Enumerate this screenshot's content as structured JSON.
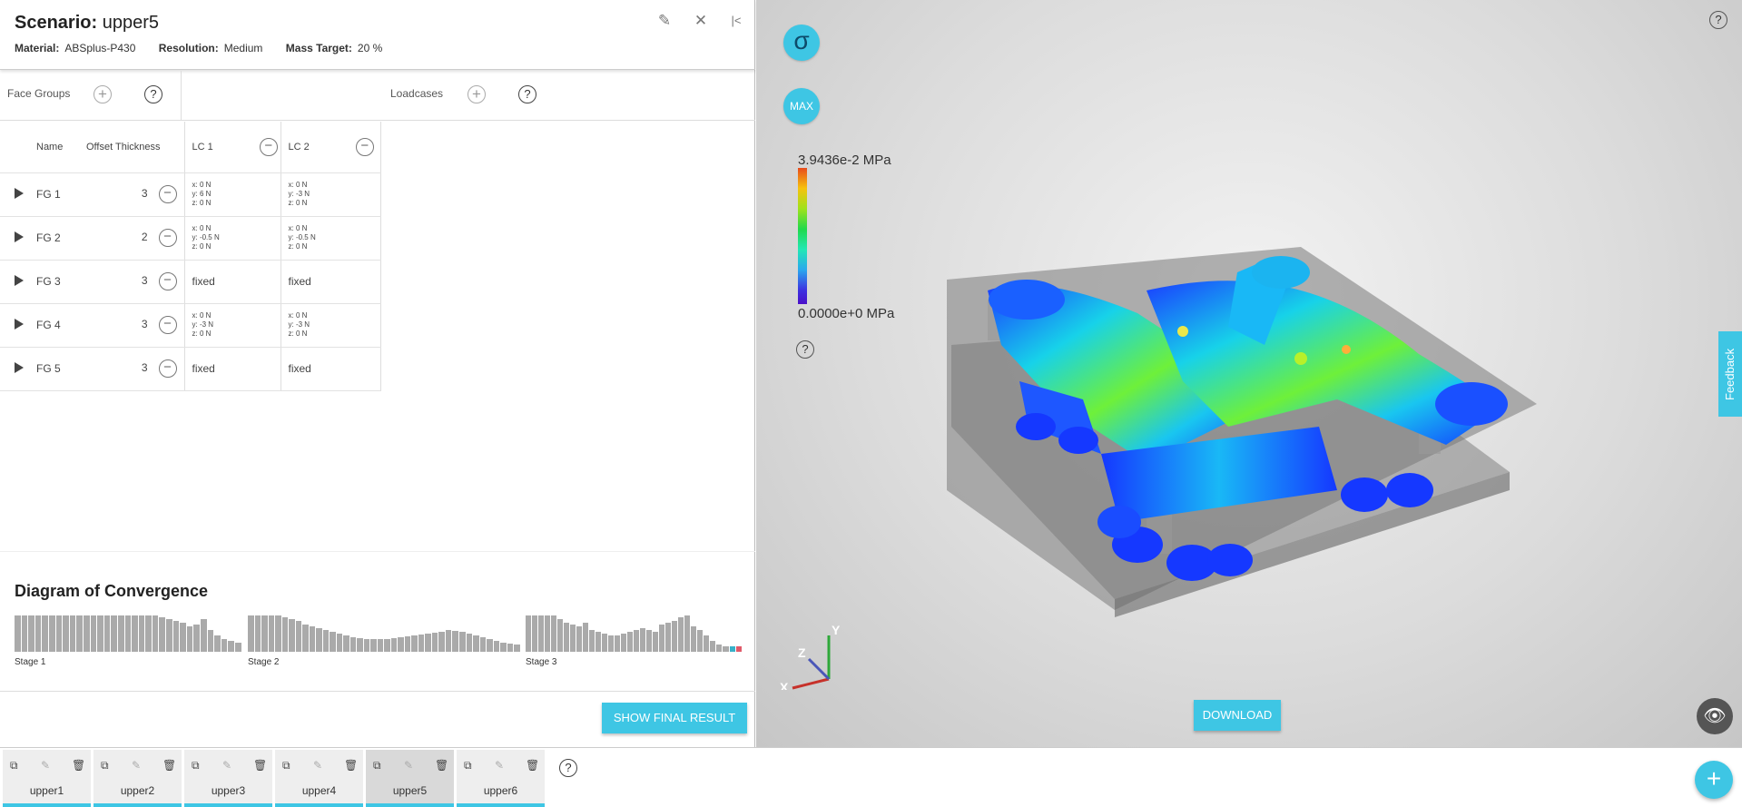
{
  "header": {
    "scenario_label": "Scenario:",
    "scenario_name": "upper5",
    "material_label": "Material:",
    "material": "ABSplus-P430",
    "resolution_label": "Resolution:",
    "resolution": "Medium",
    "mass_label": "Mass Target:",
    "mass": "20 %"
  },
  "sections": {
    "face_groups": "Face Groups",
    "loadcases": "Loadcases",
    "help": "?"
  },
  "table": {
    "col_name": "Name",
    "col_offset": "Offset Thickness",
    "lc1": "LC 1",
    "lc2": "LC 2",
    "rows": [
      {
        "name": "FG 1",
        "offset": "3",
        "lc1": [
          "x: 0 N",
          "y: 6 N",
          "z: 0 N"
        ],
        "lc2": [
          "x: 0 N",
          "y: -3 N",
          "z: 0 N"
        ]
      },
      {
        "name": "FG 2",
        "offset": "2",
        "lc1": [
          "x: 0 N",
          "y: -0.5 N",
          "z: 0 N"
        ],
        "lc2": [
          "x: 0 N",
          "y: -0.5 N",
          "z: 0 N"
        ]
      },
      {
        "name": "FG 3",
        "offset": "3",
        "lc1": "fixed",
        "lc2": "fixed"
      },
      {
        "name": "FG 4",
        "offset": "3",
        "lc1": [
          "x: 0 N",
          "y: -3 N",
          "z: 0 N"
        ],
        "lc2": [
          "x: 0 N",
          "y: -3 N",
          "z: 0 N"
        ]
      },
      {
        "name": "FG 5",
        "offset": "3",
        "lc1": "fixed",
        "lc2": "fixed"
      }
    ]
  },
  "convergence": {
    "title": "Diagram of Convergence",
    "stages": [
      {
        "label": "Stage 1",
        "values": [
          1,
          1,
          1,
          1,
          1,
          1,
          1,
          1,
          1,
          1,
          1,
          1,
          1,
          1,
          1,
          1,
          1,
          1,
          1,
          1,
          1,
          0.95,
          0.9,
          0.85,
          0.8,
          0.7,
          0.75,
          0.9,
          0.6,
          0.45,
          0.35,
          0.3,
          0.25
        ]
      },
      {
        "label": "Stage 2",
        "values": [
          1,
          1,
          1,
          1,
          1,
          0.95,
          0.9,
          0.85,
          0.75,
          0.7,
          0.65,
          0.6,
          0.55,
          0.5,
          0.45,
          0.4,
          0.38,
          0.36,
          0.35,
          0.35,
          0.36,
          0.38,
          0.4,
          0.42,
          0.45,
          0.48,
          0.5,
          0.52,
          0.55,
          0.6,
          0.58,
          0.55,
          0.5,
          0.45,
          0.4,
          0.35,
          0.3,
          0.25,
          0.22,
          0.2
        ]
      },
      {
        "label": "Stage 3",
        "values": [
          1,
          1,
          1,
          1,
          1,
          0.9,
          0.8,
          0.75,
          0.7,
          0.8,
          0.6,
          0.55,
          0.5,
          0.45,
          0.45,
          0.5,
          0.55,
          0.6,
          0.65,
          0.6,
          0.55,
          0.75,
          0.8,
          0.85,
          0.95,
          1,
          0.7,
          0.6,
          0.45,
          0.3,
          0.2,
          0.15,
          0.15,
          0.15
        ]
      }
    ],
    "highlight_colors": [
      "#e05a6a",
      "#39b0c8"
    ]
  },
  "buttons": {
    "show_final": "SHOW FINAL RESULT",
    "download": "DOWNLOAD",
    "max": "MAX",
    "sigma": "σ",
    "feedback": "Feedback"
  },
  "legend": {
    "max_value": "3.9436e-2 MPa",
    "min_value": "0.0000e+0 MPa"
  },
  "axes": {
    "x": "X",
    "y": "Y",
    "z": "Z"
  },
  "tabs": [
    "upper1",
    "upper2",
    "upper3",
    "upper4",
    "upper5",
    "upper6"
  ],
  "selected_tab": "upper5",
  "colors": {
    "accent": "#3ec6e4"
  }
}
